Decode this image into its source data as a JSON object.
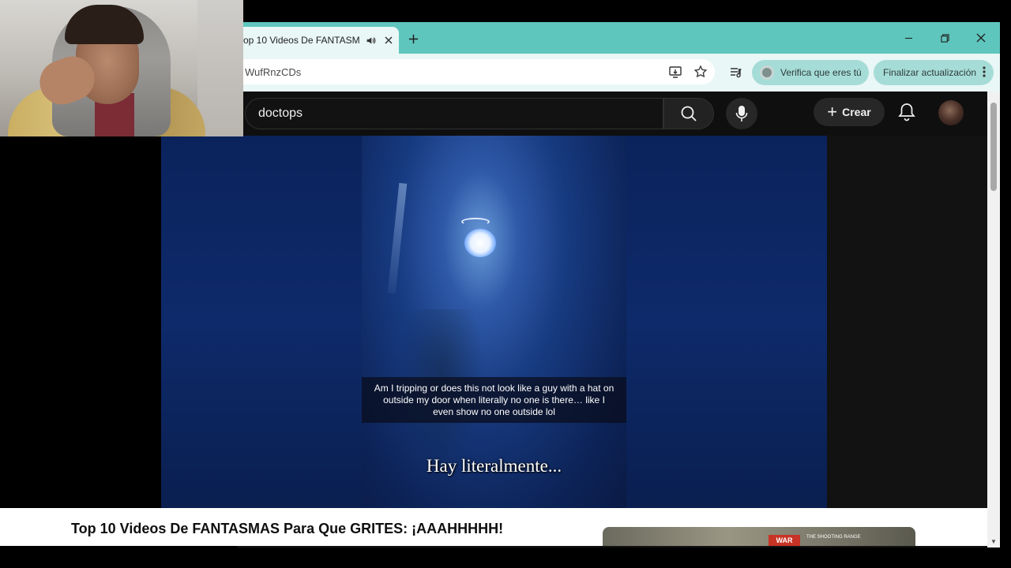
{
  "browser": {
    "tab_title": "Top 10 Videos De FANTASMAS Para Que GRITES: ¡AAAHHHHH!",
    "tab_title_visible": "op 10 Videos De FANTASM",
    "url": "WufRnzCDs",
    "verify_label": "Verifica que eres tú",
    "finalize_label": "Finalizar actualización",
    "colors": {
      "tabbar": "#5fc6bd",
      "toolbar": "#e9f7f6",
      "pill": "#a6dcd7"
    }
  },
  "youtube": {
    "search_value": "doctops",
    "create_label": "Crear",
    "video": {
      "caption": "Am I tripping or does this not look like a guy with a hat on outside my door when literally no one is there… like I even show no one outside lol",
      "subtitle": "Hay literalmente..."
    },
    "title": "Top 10 Videos De FANTASMAS Para Que GRITES: ¡AAAHHHHH!",
    "ad": {
      "logo": "WAR",
      "tag": "THE SHOOTING RANGE"
    }
  }
}
